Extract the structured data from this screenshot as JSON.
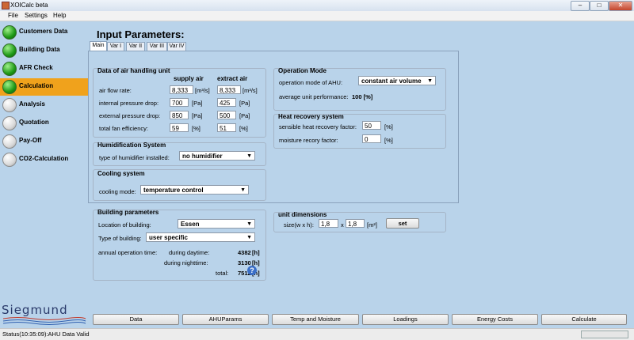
{
  "window": {
    "title": "XOICalc beta"
  },
  "menu": [
    "File",
    "Settings",
    "Help"
  ],
  "sidebar": {
    "items": [
      {
        "label": "Customers Data",
        "status": "green"
      },
      {
        "label": "Building Data",
        "status": "green"
      },
      {
        "label": "AFR Check",
        "status": "green"
      },
      {
        "label": "Calculation",
        "status": "green",
        "active": true
      },
      {
        "label": "Analysis",
        "status": "gray"
      },
      {
        "label": "Quotation",
        "status": "gray"
      },
      {
        "label": "Pay-Off",
        "status": "gray"
      },
      {
        "label": "CO2-Calculation",
        "status": "gray"
      }
    ],
    "logo": "Siegmund"
  },
  "main": {
    "title": "Input Parameters:",
    "tabs": [
      "Main",
      "Var I",
      "Var II",
      "Var III",
      "Var IV"
    ]
  },
  "air": {
    "title": "Data of air handling unit",
    "col_supply": "supply air",
    "col_extract": "extract air",
    "rows": [
      {
        "label": "air flow rate:",
        "supply": "8,333",
        "supply_unit": "[m³/s]",
        "extract": "8,333",
        "extract_unit": "[m³/s]"
      },
      {
        "label": "internal pressure drop:",
        "supply": "700",
        "supply_unit": "[Pa]",
        "extract": "425",
        "extract_unit": "[Pa]"
      },
      {
        "label": "external pressure drop:",
        "supply": "850",
        "supply_unit": "[Pa]",
        "extract": "500",
        "extract_unit": "[Pa]"
      },
      {
        "label": "total fan efficiency:",
        "supply": "59",
        "supply_unit": "[%]",
        "extract": "51",
        "extract_unit": "[%]"
      }
    ]
  },
  "humid": {
    "title": "Humidification System",
    "label": "type of humidifier installed:",
    "value": "no humidifier"
  },
  "cooling": {
    "title": "Cooling system",
    "label": "cooling mode:",
    "value": "temperature control"
  },
  "operation": {
    "title": "Operation Mode",
    "mode_label": "operation mode of AHU:",
    "mode_value": "constant air volume",
    "perf_label": "average unit performance:",
    "perf_value": "100 [%]"
  },
  "heat": {
    "title": "Heat recovery system",
    "sensible_label": "sensible heat recovery factor:",
    "sensible_value": "50",
    "moisture_label": "moisture recory factor:",
    "moisture_value": "0",
    "unit": "[%]"
  },
  "building": {
    "title": "Building parameters",
    "location_label": "Location of building:",
    "location_value": "Essen",
    "type_label": "Type of building:",
    "type_value": "user specific",
    "annual_label": "annual operation time:",
    "day_label": "during daytime:",
    "day_value": "4382",
    "night_label": "during nighttime:",
    "night_value": "3130",
    "total_label": "total:",
    "total_value": "7512",
    "hour_unit": "[h]"
  },
  "unitdim": {
    "title": "unit dimensions",
    "size_label": "size(w x h):",
    "w": "1,8",
    "x": "x",
    "h": "1,8",
    "unit": "[m²]",
    "set_label": "set"
  },
  "bottom_buttons": [
    "Data",
    "AHUParams",
    "Temp and Moisture",
    "Loadings",
    "Energy Costs",
    "Calculate"
  ],
  "status": {
    "text": "Status(10:35:09):AHU Data Valid"
  },
  "colors": {
    "active_nav": "#f0a21c",
    "background": "#b9d3ea",
    "status_green": "#1e9a16"
  }
}
